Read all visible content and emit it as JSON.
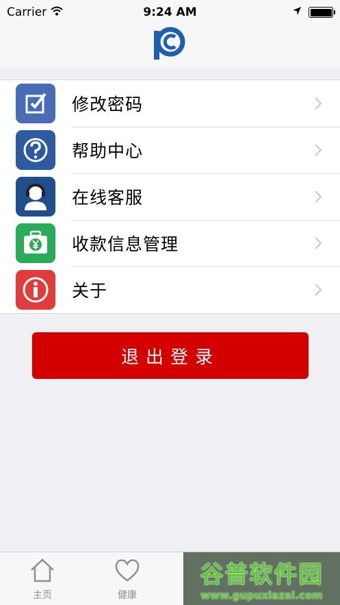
{
  "status_bar": {
    "carrier": "Carrier",
    "time": "9:24 AM"
  },
  "menu": {
    "items": [
      {
        "label": "修改密码",
        "icon": "edit-icon",
        "color": "#4a6bb5"
      },
      {
        "label": "帮助中心",
        "icon": "question-icon",
        "color": "#2d5aa0"
      },
      {
        "label": "在线客服",
        "icon": "support-agent-icon",
        "color": "#1f4f8f"
      },
      {
        "label": "收款信息管理",
        "icon": "yuan-wallet-icon",
        "color": "#2aab58"
      },
      {
        "label": "关于",
        "icon": "info-icon",
        "color": "#e03c3c"
      }
    ]
  },
  "logout": {
    "label": "退出登录",
    "color": "#d40000"
  },
  "tabbar": {
    "tabs": [
      {
        "label": "主页",
        "icon": "home-icon"
      },
      {
        "label": "健康",
        "icon": "heart-icon"
      }
    ]
  },
  "watermark": {
    "title": "谷普软件园",
    "url": "www.gupuxiazai.com"
  }
}
